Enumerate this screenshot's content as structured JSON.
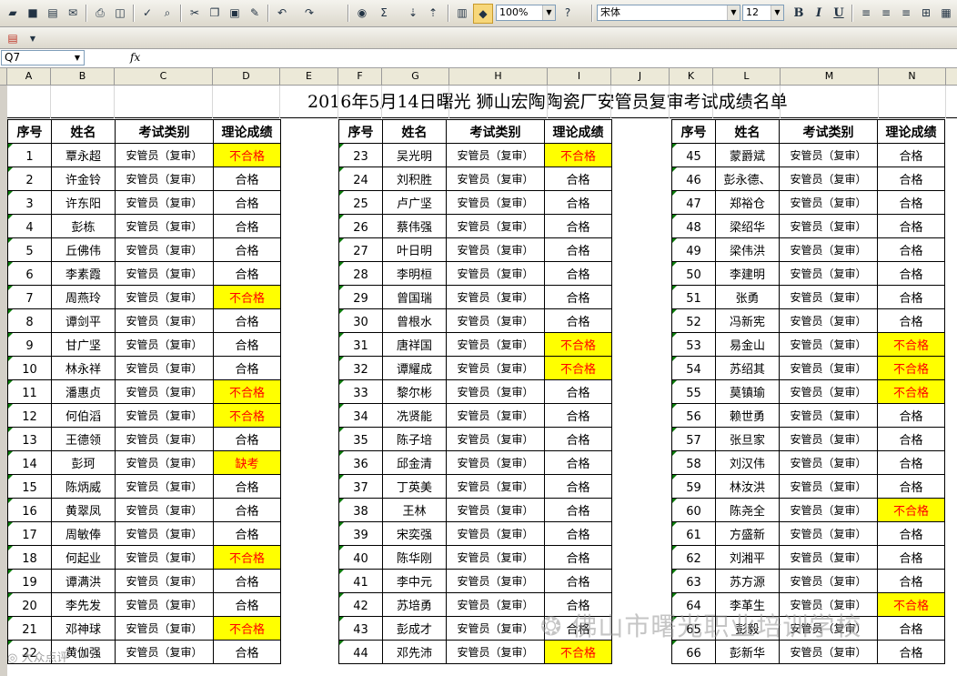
{
  "toolbar": {
    "zoom": "100%",
    "font_name": "宋体",
    "font_size": "12",
    "bold": "B",
    "italic": "I",
    "underline": "U",
    "sum": "Σ"
  },
  "formula_bar": {
    "name_box": "Q7",
    "fx_label": "fx",
    "content": ""
  },
  "columns": [
    "A",
    "B",
    "C",
    "D",
    "E",
    "F",
    "G",
    "H",
    "I",
    "J",
    "K",
    "L",
    "M",
    "N"
  ],
  "sheet": {
    "title": "2016年5月14日曙光 狮山宏陶陶瓷厂安管员复审考试成绩名单",
    "headers": [
      "序号",
      "姓名",
      "考试类别",
      "理论成绩"
    ],
    "blocks": [
      {
        "rows": [
          {
            "no": "1",
            "name": "覃永超",
            "type": "安管员（复审）",
            "score": "不合格",
            "fail": true
          },
          {
            "no": "2",
            "name": "许金铃",
            "type": "安管员（复审）",
            "score": "合格",
            "fail": false
          },
          {
            "no": "3",
            "name": "许东阳",
            "type": "安管员（复审）",
            "score": "合格",
            "fail": false
          },
          {
            "no": "4",
            "name": "彭栋",
            "type": "安管员（复审）",
            "score": "合格",
            "fail": false
          },
          {
            "no": "5",
            "name": "丘佛伟",
            "type": "安管员（复审）",
            "score": "合格",
            "fail": false
          },
          {
            "no": "6",
            "name": "李素霞",
            "type": "安管员（复审）",
            "score": "合格",
            "fail": false
          },
          {
            "no": "7",
            "name": "周燕玲",
            "type": "安管员（复审）",
            "score": "不合格",
            "fail": true
          },
          {
            "no": "8",
            "name": "谭剑平",
            "type": "安管员（复审）",
            "score": "合格",
            "fail": false
          },
          {
            "no": "9",
            "name": "甘广坚",
            "type": "安管员（复审）",
            "score": "合格",
            "fail": false
          },
          {
            "no": "10",
            "name": "林永祥",
            "type": "安管员（复审）",
            "score": "合格",
            "fail": false
          },
          {
            "no": "11",
            "name": "潘惠贞",
            "type": "安管员（复审）",
            "score": "不合格",
            "fail": true
          },
          {
            "no": "12",
            "name": "何伯滔",
            "type": "安管员（复审）",
            "score": "不合格",
            "fail": true
          },
          {
            "no": "13",
            "name": "王德领",
            "type": "安管员（复审）",
            "score": "合格",
            "fail": false
          },
          {
            "no": "14",
            "name": "彭珂",
            "type": "安管员（复审）",
            "score": "缺考",
            "fail": true
          },
          {
            "no": "15",
            "name": "陈炳威",
            "type": "安管员（复审）",
            "score": "合格",
            "fail": false
          },
          {
            "no": "16",
            "name": "黄翠凤",
            "type": "安管员（复审）",
            "score": "合格",
            "fail": false
          },
          {
            "no": "17",
            "name": "周敏俸",
            "type": "安管员（复审）",
            "score": "合格",
            "fail": false
          },
          {
            "no": "18",
            "name": "何起业",
            "type": "安管员（复审）",
            "score": "不合格",
            "fail": true
          },
          {
            "no": "19",
            "name": "谭满洪",
            "type": "安管员（复审）",
            "score": "合格",
            "fail": false
          },
          {
            "no": "20",
            "name": "李先发",
            "type": "安管员（复审）",
            "score": "合格",
            "fail": false
          },
          {
            "no": "21",
            "name": "邓神球",
            "type": "安管员（复审）",
            "score": "不合格",
            "fail": true
          },
          {
            "no": "22",
            "name": "黄伽强",
            "type": "安管员（复审）",
            "score": "合格",
            "fail": false
          }
        ]
      },
      {
        "rows": [
          {
            "no": "23",
            "name": "吴光明",
            "type": "安管员（复审）",
            "score": "不合格",
            "fail": true
          },
          {
            "no": "24",
            "name": "刘积胜",
            "type": "安管员（复审）",
            "score": "合格",
            "fail": false
          },
          {
            "no": "25",
            "name": "卢广坚",
            "type": "安管员（复审）",
            "score": "合格",
            "fail": false
          },
          {
            "no": "26",
            "name": "蔡伟强",
            "type": "安管员（复审）",
            "score": "合格",
            "fail": false
          },
          {
            "no": "27",
            "name": "叶日明",
            "type": "安管员（复审）",
            "score": "合格",
            "fail": false
          },
          {
            "no": "28",
            "name": "李明桓",
            "type": "安管员（复审）",
            "score": "合格",
            "fail": false
          },
          {
            "no": "29",
            "name": "曾国瑞",
            "type": "安管员（复审）",
            "score": "合格",
            "fail": false
          },
          {
            "no": "30",
            "name": "曾根水",
            "type": "安管员（复审）",
            "score": "合格",
            "fail": false
          },
          {
            "no": "31",
            "name": "唐祥国",
            "type": "安管员（复审）",
            "score": "不合格",
            "fail": true
          },
          {
            "no": "32",
            "name": "谭耀成",
            "type": "安管员（复审）",
            "score": "不合格",
            "fail": true
          },
          {
            "no": "33",
            "name": "黎尔彬",
            "type": "安管员（复审）",
            "score": "合格",
            "fail": false
          },
          {
            "no": "34",
            "name": "冼贤能",
            "type": "安管员（复审）",
            "score": "合格",
            "fail": false
          },
          {
            "no": "35",
            "name": "陈子培",
            "type": "安管员（复审）",
            "score": "合格",
            "fail": false
          },
          {
            "no": "36",
            "name": "邱金清",
            "type": "安管员（复审）",
            "score": "合格",
            "fail": false
          },
          {
            "no": "37",
            "name": "丁英美",
            "type": "安管员（复审）",
            "score": "合格",
            "fail": false
          },
          {
            "no": "38",
            "name": "王林",
            "type": "安管员（复审）",
            "score": "合格",
            "fail": false
          },
          {
            "no": "39",
            "name": "宋奕强",
            "type": "安管员（复审）",
            "score": "合格",
            "fail": false
          },
          {
            "no": "40",
            "name": "陈华刚",
            "type": "安管员（复审）",
            "score": "合格",
            "fail": false
          },
          {
            "no": "41",
            "name": "李中元",
            "type": "安管员（复审）",
            "score": "合格",
            "fail": false
          },
          {
            "no": "42",
            "name": "苏培勇",
            "type": "安管员（复审）",
            "score": "合格",
            "fail": false
          },
          {
            "no": "43",
            "name": "彭成才",
            "type": "安管员（复审）",
            "score": "合格",
            "fail": false
          },
          {
            "no": "44",
            "name": "邓先沛",
            "type": "安管员（复审）",
            "score": "不合格",
            "fail": true
          }
        ]
      },
      {
        "rows": [
          {
            "no": "45",
            "name": "蒙爵斌",
            "type": "安管员（复审）",
            "score": "合格",
            "fail": false
          },
          {
            "no": "46",
            "name": "彭永德、",
            "type": "安管员（复审）",
            "score": "合格",
            "fail": false
          },
          {
            "no": "47",
            "name": "郑裕仓",
            "type": "安管员（复审）",
            "score": "合格",
            "fail": false
          },
          {
            "no": "48",
            "name": "梁绍华",
            "type": "安管员（复审）",
            "score": "合格",
            "fail": false
          },
          {
            "no": "49",
            "name": "梁伟洪",
            "type": "安管员（复审）",
            "score": "合格",
            "fail": false
          },
          {
            "no": "50",
            "name": "李建明",
            "type": "安管员（复审）",
            "score": "合格",
            "fail": false
          },
          {
            "no": "51",
            "name": "张勇",
            "type": "安管员（复审）",
            "score": "合格",
            "fail": false
          },
          {
            "no": "52",
            "name": "冯新宪",
            "type": "安管员（复审）",
            "score": "合格",
            "fail": false
          },
          {
            "no": "53",
            "name": "易金山",
            "type": "安管员（复审）",
            "score": "不合格",
            "fail": true
          },
          {
            "no": "54",
            "name": "苏绍其",
            "type": "安管员（复审）",
            "score": "不合格",
            "fail": true
          },
          {
            "no": "55",
            "name": "莫镇瑜",
            "type": "安管员（复审）",
            "score": "不合格",
            "fail": true
          },
          {
            "no": "56",
            "name": "赖世勇",
            "type": "安管员（复审）",
            "score": "合格",
            "fail": false
          },
          {
            "no": "57",
            "name": "张旦家",
            "type": "安管员（复审）",
            "score": "合格",
            "fail": false
          },
          {
            "no": "58",
            "name": "刘汉伟",
            "type": "安管员（复审）",
            "score": "合格",
            "fail": false
          },
          {
            "no": "59",
            "name": "林汝洪",
            "type": "安管员（复审）",
            "score": "合格",
            "fail": false
          },
          {
            "no": "60",
            "name": "陈尧全",
            "type": "安管员（复审）",
            "score": "不合格",
            "fail": true
          },
          {
            "no": "61",
            "name": "方盛新",
            "type": "安管员（复审）",
            "score": "合格",
            "fail": false
          },
          {
            "no": "62",
            "name": "刘湘平",
            "type": "安管员（复审）",
            "score": "合格",
            "fail": false
          },
          {
            "no": "63",
            "name": "苏方源",
            "type": "安管员（复审）",
            "score": "合格",
            "fail": false
          },
          {
            "no": "64",
            "name": "李革生",
            "type": "安管员（复审）",
            "score": "不合格",
            "fail": true
          },
          {
            "no": "65",
            "name": "彭毅",
            "type": "安管员（复审）",
            "score": "合格",
            "fail": false
          },
          {
            "no": "66",
            "name": "彭新华",
            "type": "安管员（复审）",
            "score": "合格",
            "fail": false
          }
        ]
      }
    ]
  },
  "watermark": {
    "text": "佛山市曙光职业培训学校",
    "corner": "大众点评"
  },
  "colors": {
    "fail_bg": "#ffff00",
    "fail_text": "#ff0000"
  }
}
